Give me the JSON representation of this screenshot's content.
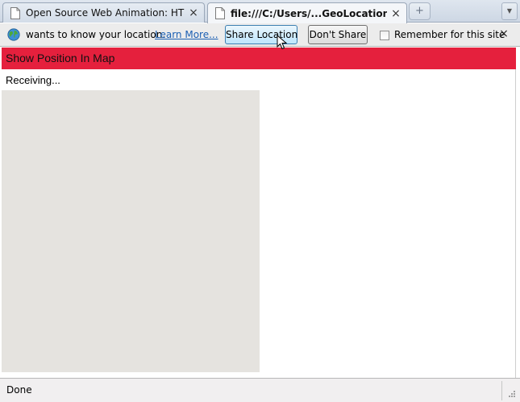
{
  "tabs": [
    {
      "title": "Open Source Web Animation: HTM...",
      "close": "×",
      "active": false
    },
    {
      "title": "file:///C:/Users/...GeoLocation.html",
      "close": "×",
      "active": true
    }
  ],
  "tabstrip": {
    "new_tab_glyph": "+",
    "list_glyph": "▼"
  },
  "notification": {
    "message": "wants to know your location.",
    "learn_more": "Learn More...",
    "share_button": "Share Location",
    "dont_share_button": "Don't Share",
    "remember_label": "Remember for this site",
    "remember_checked": false,
    "close": "×"
  },
  "page": {
    "header": "Show Position In Map",
    "status_message": "Receiving...",
    "map_background": "#e5e3df",
    "header_color": "#e5203d"
  },
  "statusbar": {
    "text": "Done"
  }
}
